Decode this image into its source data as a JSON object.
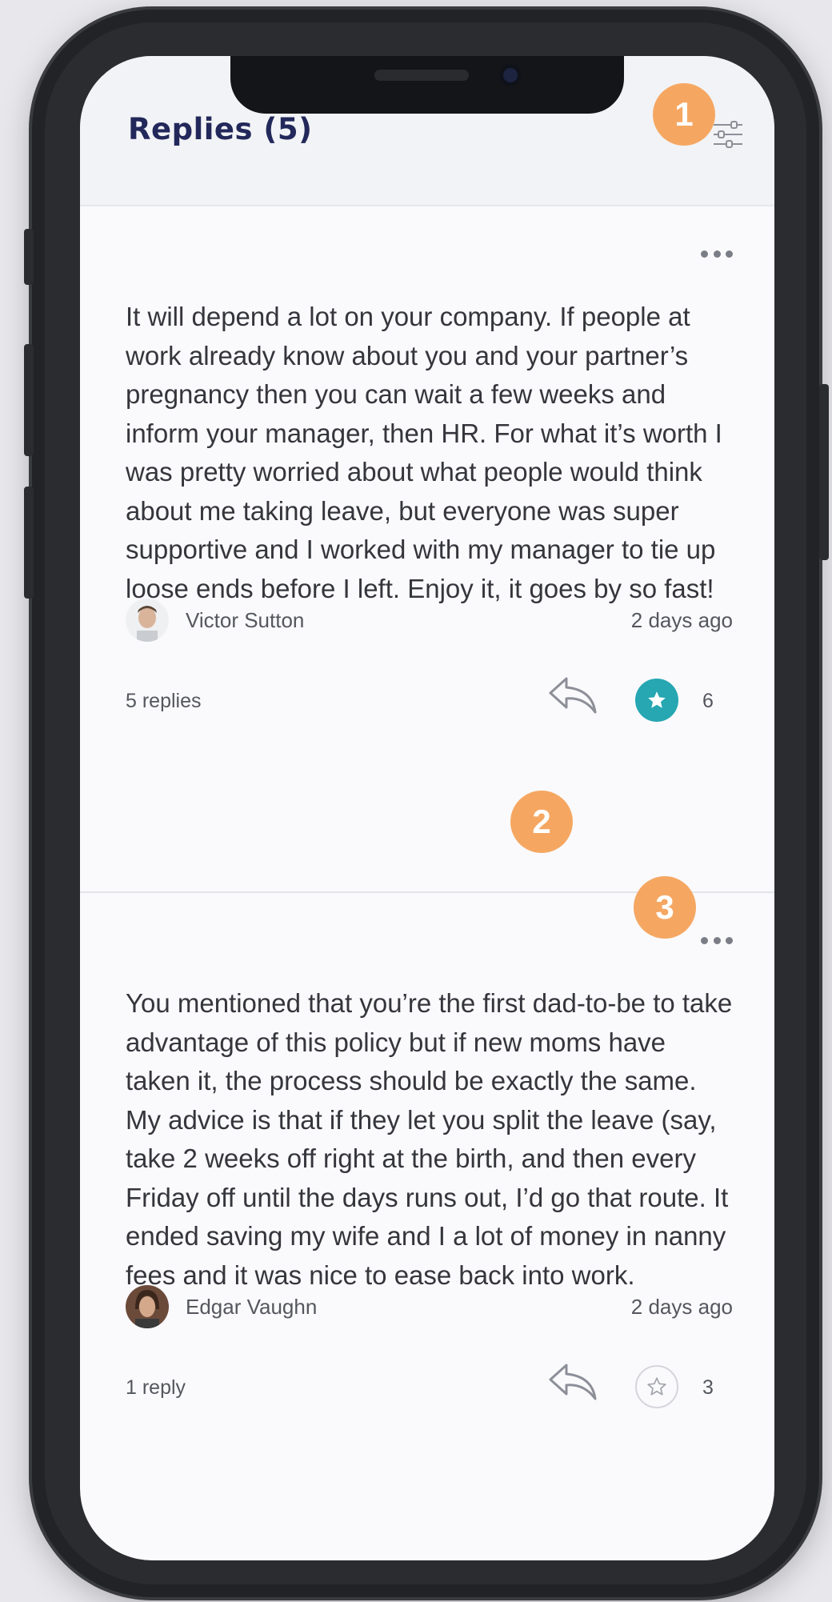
{
  "header": {
    "title": "Replies (5)"
  },
  "annotations": [
    "1",
    "2",
    "3"
  ],
  "posts": [
    {
      "text": "It will depend a lot on your company. If people at work already know about you and your partner’s pregnancy then you can wait a few weeks and inform your manager, then HR. For what it’s worth I was pretty worried about what people would think about me taking leave, but everyone was super supportive and I worked with my manager to tie up loose ends before I left. Enjoy it, it goes by so fast!",
      "author": "Victor Sutton",
      "time": "2 days ago",
      "replies": "5 replies",
      "star_count": "6",
      "starred": true
    },
    {
      "text": "You mentioned that you’re the first dad-to-be to take advantage of this policy but if new moms have taken it, the process should be exactly the same. My advice is that if they let you split the leave (say, take 2 weeks off right at the birth, and then every Friday off until the days runs out, I’d go that route. It ended saving my wife and I a lot of money in nanny fees and it was nice to ease back into work.",
      "author": "Edgar Vaughn",
      "time": "2 days ago",
      "replies": "1 reply",
      "star_count": "3",
      "starred": false
    }
  ],
  "colors": {
    "title": "#22285a",
    "star_active": "#26a7b2",
    "annotation": "#f5a762"
  }
}
